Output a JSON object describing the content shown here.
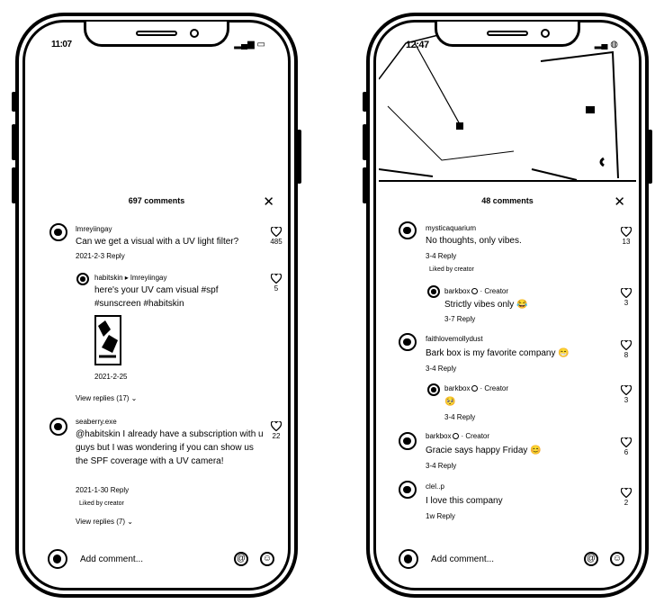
{
  "left": {
    "status_time": "11:07",
    "comments_count": "697 comments",
    "comments": [
      {
        "username": "lmreyiingay",
        "text": "Can we get a visual with a UV light filter?",
        "meta": "2021-2-3  Reply",
        "likes": "485"
      },
      {
        "username": "habitskin ▸ lmreyiingay",
        "text": "here's your UV cam visual #spf #sunscreen #habitskin",
        "meta": "2021-2-25",
        "likes": "5"
      },
      {
        "username": "seaberry.exe",
        "text": "@habitskin I already have a subscription with u guys but I was wondering if you can show us the SPF coverage with a UV camera!",
        "meta": "2021-1-30  Reply",
        "liked_by": "Liked by creator",
        "likes": "22"
      }
    ],
    "view_replies_1": "View replies (17) ⌄",
    "view_replies_2": "View replies (7) ⌄",
    "add_comment": "Add comment..."
  },
  "right": {
    "status_time": "12:47",
    "comments_count": "48 comments",
    "comments": [
      {
        "username": "mysticaquarium",
        "text": "No thoughts, only vibes.",
        "meta": "3-4  Reply",
        "liked_by": "Liked by creator",
        "likes": "13"
      },
      {
        "username": "barkbox",
        "creator": "Creator",
        "text": "Strictly vibes only 😂",
        "meta": "3-7  Reply",
        "likes": "3"
      },
      {
        "username": "faithlovemollydust",
        "text": "Bark box is my favorite company 😁",
        "meta": "3-4  Reply",
        "likes": "8"
      },
      {
        "username": "barkbox",
        "creator": "Creator",
        "text": "🥺",
        "meta": "3-4  Reply",
        "likes": "3"
      },
      {
        "username": "barkbox",
        "creator": "Creator",
        "text": "Gracie says happy Friday 😊",
        "meta": "3-4  Reply",
        "likes": "6"
      },
      {
        "username": "clel..p",
        "text": "I love this company",
        "meta": "1w  Reply",
        "likes": "2"
      }
    ],
    "add_comment": "Add comment..."
  },
  "icons": {
    "heart": "heart-icon",
    "close": "close-icon",
    "mention": "at-icon",
    "emoji": "emoji-icon"
  }
}
